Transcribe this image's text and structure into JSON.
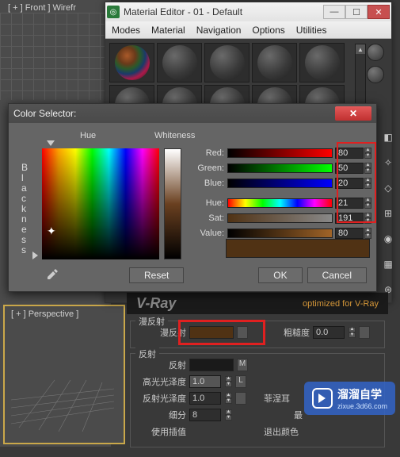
{
  "viewports": {
    "front_label": "[ + ] Front ] Wirefr",
    "perspective_label": "[ + ] Perspective ]"
  },
  "material_editor": {
    "title": "Material Editor - 01 - Default",
    "menus": {
      "modes": "Modes",
      "material": "Material",
      "navigation": "Navigation",
      "options": "Options",
      "utilities": "Utilities"
    }
  },
  "color_selector": {
    "title": "Color Selector:",
    "hue_label": "Hue",
    "whiteness_label": "Whiteness",
    "blackness_letters": [
      "B",
      "l",
      "a",
      "c",
      "k",
      "n",
      "e",
      "s",
      "s"
    ],
    "channels": {
      "red": {
        "label": "Red:",
        "value": "80"
      },
      "green": {
        "label": "Green:",
        "value": "50"
      },
      "blue": {
        "label": "Blue:",
        "value": "20"
      },
      "hue": {
        "label": "Hue:",
        "value": "21"
      },
      "sat": {
        "label": "Sat:",
        "value": "191"
      },
      "value": {
        "label": "Value:",
        "value": "80"
      }
    },
    "reset": "Reset",
    "ok": "OK",
    "cancel": "Cancel",
    "swatch_color": "#503214"
  },
  "vray": {
    "logo": "V-Ray",
    "optimized": "optimized for V-Ray"
  },
  "params": {
    "diffuse_group": "漫反射",
    "diffuse_label": "漫反射",
    "roughness_label": "粗糙度",
    "roughness_value": "0.0",
    "diffuse_color": "#503214",
    "reflect_group": "反射",
    "reflect_label": "反射",
    "reflect_color": "#1a1a1a",
    "reflect_m": "M",
    "hgloss_label": "高光光泽度",
    "hgloss_value": "1.0",
    "hgloss_l": "L",
    "rgloss_label": "反射光泽度",
    "rgloss_value": "1.0",
    "fresnel_label": "菲涅耳",
    "subdiv_label": "细分",
    "subdiv_value": "8",
    "max_label": "最",
    "use_interp_label": "使用插值",
    "exit_color_label": "退出颜色"
  },
  "watermark": {
    "name": "溜溜自学",
    "url": "zixue.3d66.com"
  }
}
